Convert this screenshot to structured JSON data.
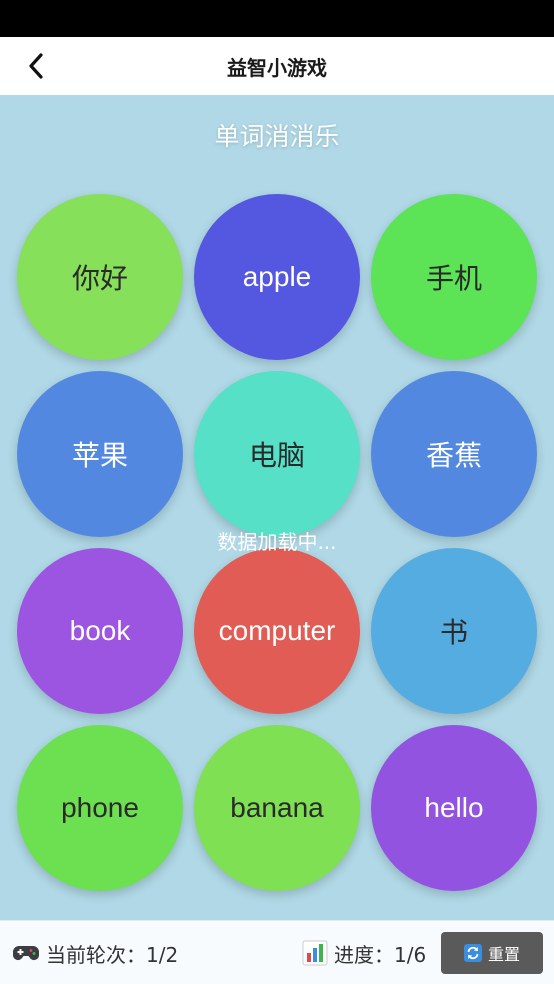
{
  "nav": {
    "title": "益智小游戏",
    "back_icon": "chevron-left-icon"
  },
  "game": {
    "title": "单词消消乐",
    "loading_text": "数据加载中...",
    "bubbles": [
      {
        "label": "你好",
        "color": "#86e05a",
        "text_color": "dark"
      },
      {
        "label": "apple",
        "color": "#5457e0",
        "text_color": "light"
      },
      {
        "label": "手机",
        "color": "#5ce356",
        "text_color": "dark"
      },
      {
        "label": "苹果",
        "color": "#5288e0",
        "text_color": "light"
      },
      {
        "label": "电脑",
        "color": "#56e0c8",
        "text_color": "dark"
      },
      {
        "label": "香蕉",
        "color": "#5288e0",
        "text_color": "light"
      },
      {
        "label": "book",
        "color": "#9b55e0",
        "text_color": "light"
      },
      {
        "label": "computer",
        "color": "#e05c54",
        "text_color": "light"
      },
      {
        "label": "书",
        "color": "#55ace0",
        "text_color": "dark"
      },
      {
        "label": "phone",
        "color": "#6de052",
        "text_color": "dark"
      },
      {
        "label": "banana",
        "color": "#7ee052",
        "text_color": "dark"
      },
      {
        "label": "hello",
        "color": "#9153e0",
        "text_color": "light"
      }
    ]
  },
  "footer": {
    "round_icon": "gamepad-icon",
    "round_label": "当前轮次：1/2",
    "progress_icon": "bar-chart-icon",
    "progress_label": "进度：1/6",
    "reset_icon": "refresh-icon",
    "reset_label": "重置"
  },
  "colors": {
    "background": "#b0d8e6",
    "reset_button": "#5a5a5a"
  }
}
